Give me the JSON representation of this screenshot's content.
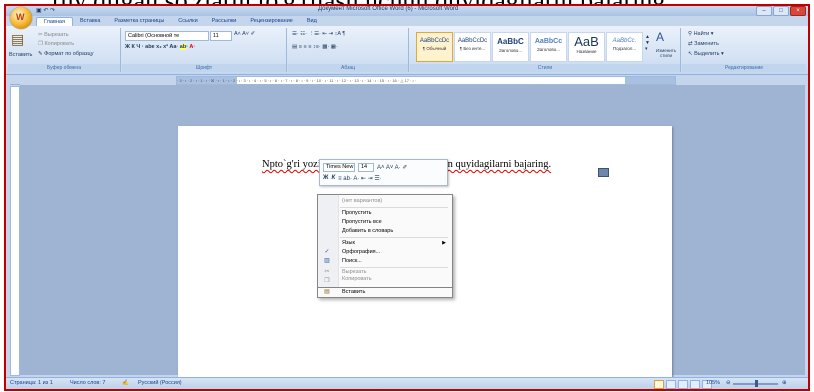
{
  "overlay_text": "ruy qilgan so'zlarni to'g'rilash uchun quyidagilarni bajaring.",
  "window": {
    "title": "Документ Microsoft Office Word (6) - Microsoft Word",
    "office_button_glyph": "W"
  },
  "ribbon_tabs": [
    "Главная",
    "Вставка",
    "Разметка страницы",
    "Ссылки",
    "Рассылки",
    "Рецензирование",
    "Вид"
  ],
  "clipboard": {
    "paste": "Вставить",
    "cut": "Вырезать",
    "copy": "Копировать",
    "format_painter": "Формат по образцу",
    "label": "Буфер обмена"
  },
  "font": {
    "family": "Calibri (Основной те",
    "size": "11",
    "label": "Шрифт"
  },
  "paragraph": {
    "label": "Абзац"
  },
  "styles": {
    "items": [
      {
        "sample": "AaBbCcDc",
        "name": "¶ Обычный"
      },
      {
        "sample": "AaBbCcDc",
        "name": "¶ Без инте..."
      },
      {
        "sample": "AaBbC",
        "name": "Заголово..."
      },
      {
        "sample": "AaBbCc",
        "name": "Заголово..."
      },
      {
        "sample": "AaB",
        "name": "Название"
      },
      {
        "sample": "AaBbCc.",
        "name": "Подзагол..."
      }
    ],
    "change_styles": "Изменить стили",
    "label": "Стили"
  },
  "editing": {
    "find": "Найти",
    "replace": "Заменить",
    "select": "Выделить",
    "label": "Редактирование"
  },
  "ruler_icon": "L",
  "ruler_text": "· 3 · ı · 2 · ı · 1 · ı · ☒ · ı · 1 · ı · 2 · ı · 3 · ı · 4 · ı · 5 · ı · 6 · ı · 7 · ı · 8 · ı · 9 · ı · 10 · ı · 11 · ı · 12 · ı · 13 · ı · 14 · ı · 15 · ı · 16 · △ 17 · ı ·",
  "document": {
    "text": "Npto`g'ri yozilgan so`zlarni to`g`irlash uchun quyidagilarni bajaring."
  },
  "mini_toolbar": {
    "font": "Times New",
    "size": "14",
    "row1_extra": "A˄ A˅ A· ✐",
    "bold": "Ж",
    "italic": "К",
    "row2_extra": "≡ ab· A· ⇤ ⇥ ☰·"
  },
  "context_menu": {
    "items": [
      {
        "label": "(нет вариантов)",
        "disabled": true,
        "icon": ""
      },
      {
        "label": "Пропустить",
        "disabled": false,
        "icon": ""
      },
      {
        "label": "Пропустить все",
        "disabled": false,
        "icon": ""
      },
      {
        "label": "Добавить в словарь",
        "disabled": false,
        "icon": ""
      },
      {
        "label": "Язык",
        "disabled": false,
        "icon": "",
        "submenu": true
      },
      {
        "label": "Орфография...",
        "disabled": false,
        "icon": "spelling-icon"
      },
      {
        "label": "Поиск...",
        "disabled": false,
        "icon": "research-icon"
      },
      {
        "label": "Вырезать",
        "disabled": true,
        "icon": "cut-icon"
      },
      {
        "label": "Копировать",
        "disabled": true,
        "icon": "copy-icon"
      },
      {
        "label": "Вставить",
        "disabled": false,
        "icon": "paste-icon"
      }
    ]
  },
  "status": {
    "page": "Страница: 1 из 1",
    "words": "Число слов: 7",
    "language": "Русский (Россия)",
    "zoom": "105%"
  }
}
